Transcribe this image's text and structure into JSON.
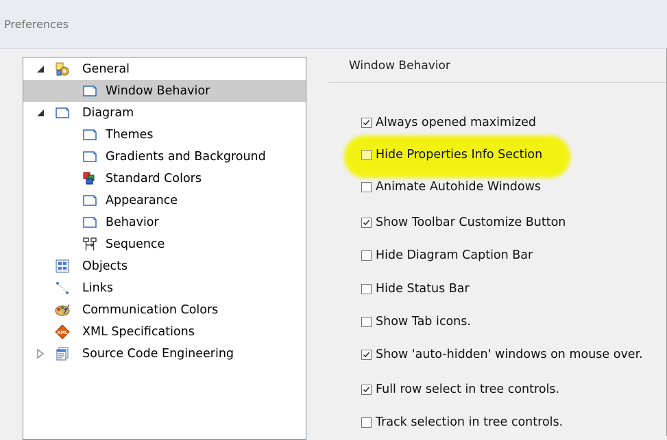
{
  "window": {
    "title": "Preferences"
  },
  "tree": {
    "items": [
      {
        "label": "General",
        "icon": "general-settings-icon",
        "expander": "expanded"
      },
      {
        "label": "Window Behavior",
        "icon": "page-icon",
        "selected": true
      },
      {
        "label": "Diagram",
        "icon": "page-icon",
        "expander": "expanded"
      },
      {
        "label": "Themes",
        "icon": "page-icon"
      },
      {
        "label": "Gradients and Background",
        "icon": "page-icon"
      },
      {
        "label": "Standard Colors",
        "icon": "color-shapes-icon"
      },
      {
        "label": "Appearance",
        "icon": "page-icon"
      },
      {
        "label": "Behavior",
        "icon": "page-icon"
      },
      {
        "label": "Sequence",
        "icon": "sequence-icon"
      },
      {
        "label": "Objects",
        "icon": "objects-icon"
      },
      {
        "label": "Links",
        "icon": "links-icon"
      },
      {
        "label": "Communication Colors",
        "icon": "palette-icon"
      },
      {
        "label": "XML Specifications",
        "icon": "xml-icon"
      },
      {
        "label": "Source Code Engineering",
        "icon": "source-code-icon",
        "expander": "collapsed"
      }
    ]
  },
  "panel": {
    "heading": "Window Behavior",
    "highlight_color": "#f3f300",
    "options": [
      {
        "label": "Always opened maximized",
        "checked": true
      },
      {
        "label": "Hide Properties Info Section",
        "checked": false,
        "highlighted": true
      },
      {
        "label": "Animate Autohide Windows",
        "checked": false
      },
      {
        "label": "Show Toolbar Customize Button",
        "checked": true
      },
      {
        "label": "Hide Diagram Caption Bar",
        "checked": false
      },
      {
        "label": "Hide Status Bar",
        "checked": false
      },
      {
        "label": "Show Tab icons.",
        "checked": false
      },
      {
        "label": "Show 'auto-hidden' windows on mouse over.",
        "checked": true
      },
      {
        "label": "Full row select in tree controls.",
        "checked": true
      },
      {
        "label": "Track selection in tree controls.",
        "checked": false
      }
    ]
  }
}
